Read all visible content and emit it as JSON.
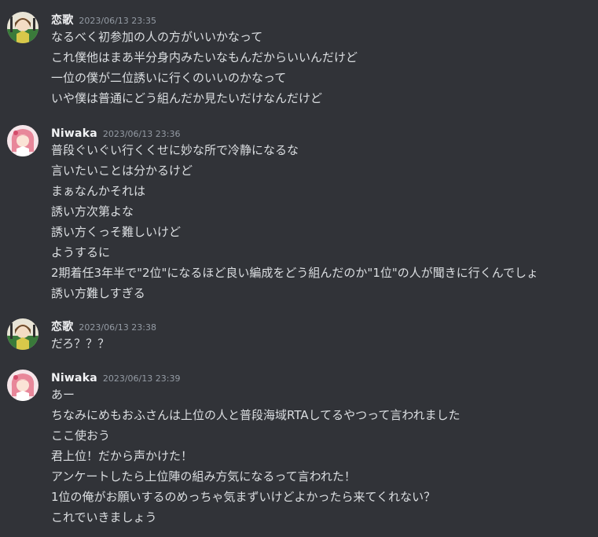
{
  "colors": {
    "background": "#313338",
    "username": "#f2f3f5",
    "timestamp": "#949ba4",
    "text": "#dbdee1"
  },
  "messages": [
    {
      "author": "恋歌",
      "time": "2023/06/13 23:35",
      "avatar": "renka-avatar",
      "lines": [
        "なるべく初参加の人の方がいいかなって",
        "これ僕他はまあ半分身内みたいなもんだからいいんだけど",
        "一位の僕が二位誘いに行くのいいのかなって",
        "いや僕は普通にどう組んだか見たいだけなんだけど"
      ]
    },
    {
      "author": "Niwaka",
      "time": "2023/06/13 23:36",
      "avatar": "niwaka-avatar",
      "lines": [
        "普段ぐいぐい行くくせに妙な所で冷静になるな",
        "言いたいことは分かるけど",
        "まぁなんかそれは",
        "誘い方次第よな",
        "誘い方くっそ難しいけど",
        "ようするに",
        "2期着任3年半で\"2位\"になるほど良い編成をどう組んだのか\"1位\"の人が聞きに行くんでしょ",
        "誘い方難しすぎる"
      ]
    },
    {
      "author": "恋歌",
      "time": "2023/06/13 23:38",
      "avatar": "renka-avatar",
      "lines": [
        "だろ？？？"
      ]
    },
    {
      "author": "Niwaka",
      "time": "2023/06/13 23:39",
      "avatar": "niwaka-avatar",
      "lines": [
        "あー",
        "ちなみにめもおふさんは上位の人と普段海域RTAしてるやつって言われました",
        "ここ使おう",
        "君上位！だから声かけた！",
        "アンケートしたら上位陣の組み方気になるって言われた！",
        "1位の俺がお願いするのめっちゃ気まずいけどよかったら来てくれない？",
        "これでいきましょう"
      ]
    }
  ]
}
